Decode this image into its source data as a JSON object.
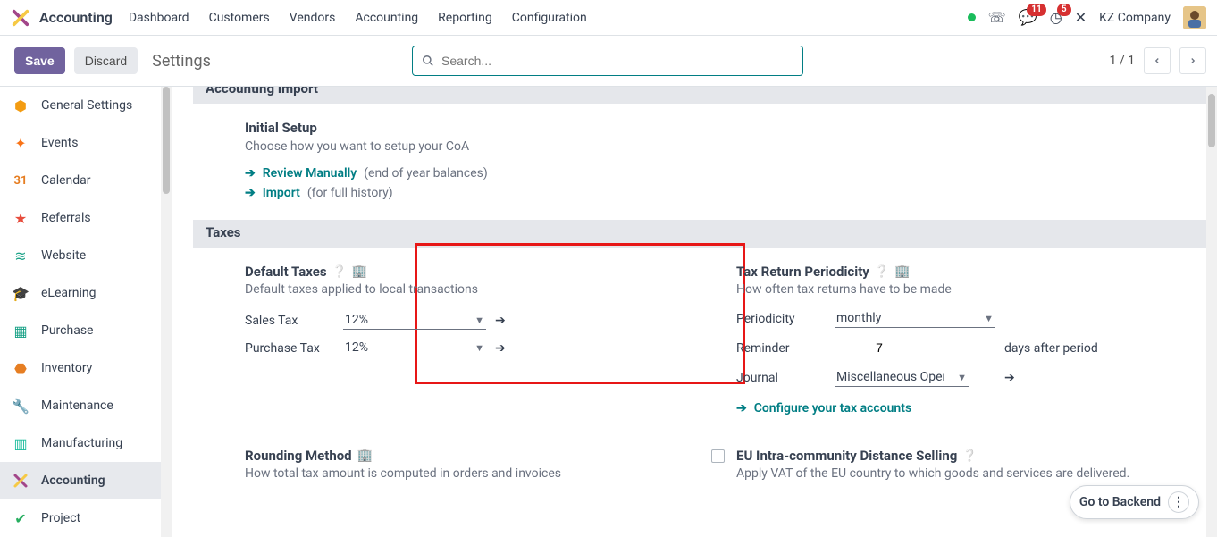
{
  "colors": {
    "accent": "#017e84",
    "primary_btn": "#71639e",
    "danger": "#e71717"
  },
  "header": {
    "app_title": "Accounting",
    "menus": [
      "Dashboard",
      "Customers",
      "Vendors",
      "Accounting",
      "Reporting",
      "Configuration"
    ],
    "company": "KZ Company",
    "badges": {
      "discuss": "11",
      "activities": "5"
    }
  },
  "control_panel": {
    "save": "Save",
    "discard": "Discard",
    "breadcrumb": "Settings",
    "search_placeholder": "Search...",
    "pager": "1 / 1"
  },
  "sidebar": {
    "items": [
      {
        "label": "General Settings",
        "icon": "⚙"
      },
      {
        "label": "Events",
        "icon": "✦"
      },
      {
        "label": "Calendar",
        "icon": "31"
      },
      {
        "label": "Referrals",
        "icon": "★"
      },
      {
        "label": "Website",
        "icon": "≈"
      },
      {
        "label": "eLearning",
        "icon": "🎓"
      },
      {
        "label": "Purchase",
        "icon": "▤"
      },
      {
        "label": "Inventory",
        "icon": "📦"
      },
      {
        "label": "Maintenance",
        "icon": "🔧"
      },
      {
        "label": "Manufacturing",
        "icon": "🏭"
      },
      {
        "label": "Accounting",
        "icon": "✎"
      },
      {
        "label": "Project",
        "icon": "✔"
      }
    ],
    "active_index": 10
  },
  "main": {
    "section_import": {
      "header": "Accounting Import",
      "setup_title": "Initial Setup",
      "setup_desc": "Choose how you want to setup your CoA",
      "review_label": "Review Manually",
      "review_suffix": "(end of year balances)",
      "import_label": "Import",
      "import_suffix": "(for full history)"
    },
    "section_taxes": {
      "header": "Taxes",
      "default_taxes": {
        "title": "Default Taxes",
        "desc": "Default taxes applied to local transactions",
        "sales_label": "Sales Tax",
        "sales_value": "12%",
        "purchase_label": "Purchase Tax",
        "purchase_value": "12%"
      },
      "tax_return": {
        "title": "Tax Return Periodicity",
        "desc": "How often tax returns have to be made",
        "periodicity_label": "Periodicity",
        "periodicity_value": "monthly",
        "reminder_label": "Reminder",
        "reminder_value": "7",
        "reminder_suffix": "days after period",
        "journal_label": "Journal",
        "journal_value": "Miscellaneous Operat",
        "configure_label": "Configure your tax accounts"
      },
      "rounding": {
        "title": "Rounding Method",
        "desc": "How total tax amount is computed in orders and invoices"
      },
      "eu_distance": {
        "title": "EU Intra-community Distance Selling",
        "desc": "Apply VAT of the EU country to which goods and services are delivered."
      }
    }
  },
  "footer": {
    "backend_label": "Go to Backend"
  }
}
